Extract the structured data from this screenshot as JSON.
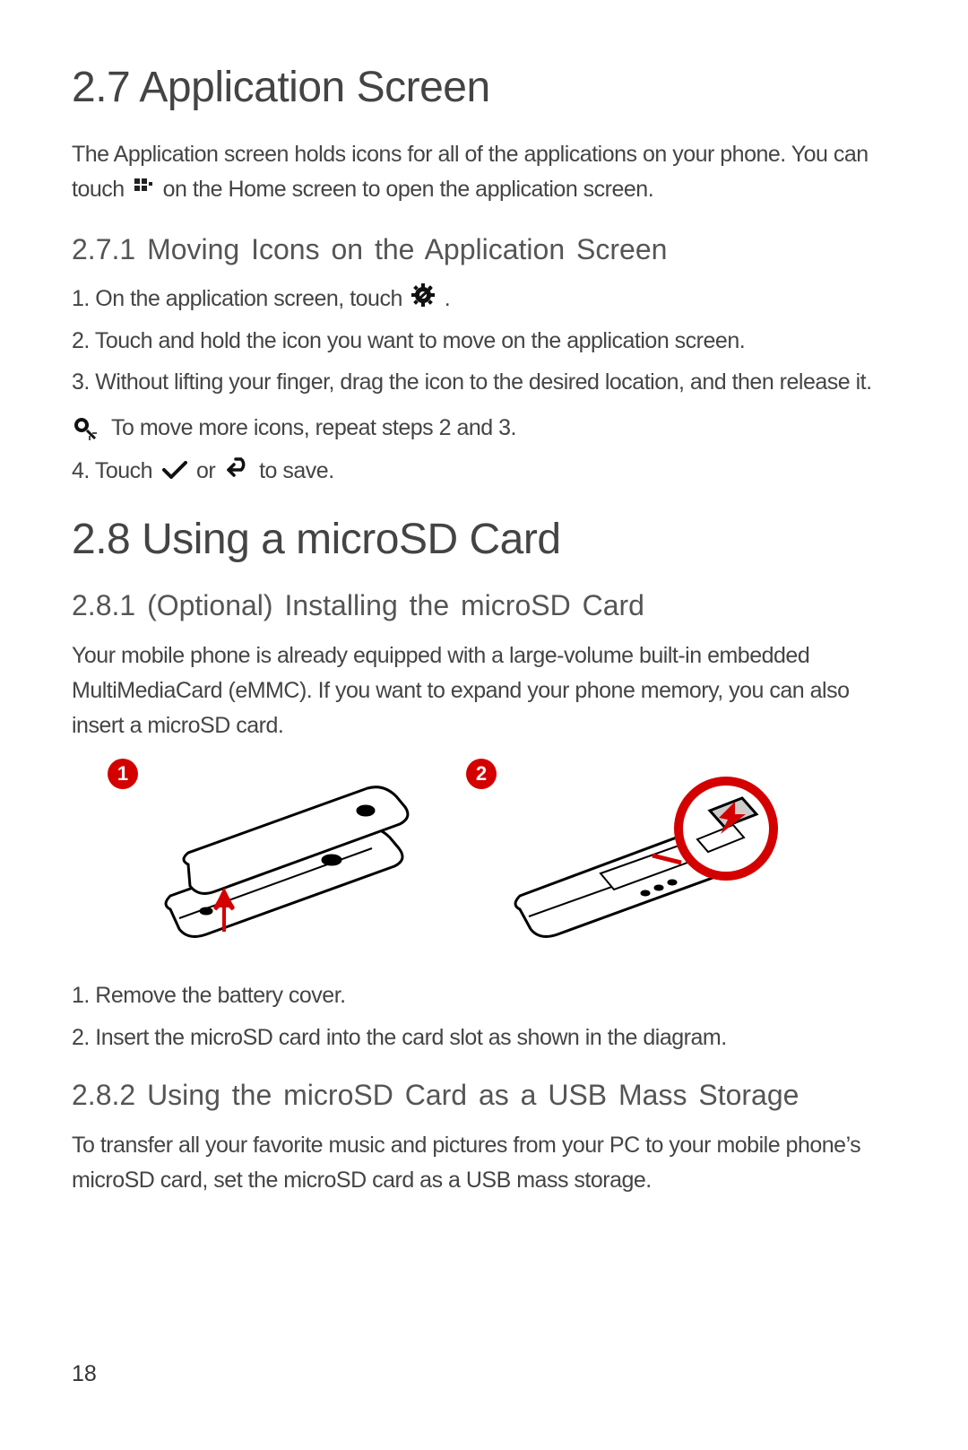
{
  "section27": {
    "heading": "2.7  Application Screen",
    "intro_part1": "The Application screen holds icons for all of the applications on your phone. You can touch ",
    "intro_part2": " on the Home screen to open the application screen.",
    "sub271": {
      "heading": "2.7.1  Moving Icons on the Application Screen",
      "step1_a": "1. On the application screen, touch ",
      "step1_b": " .",
      "step2": "2. Touch and hold the icon you want to move on the application screen.",
      "step3": "3. Without lifting your finger, drag the icon to the desired location, and then release it.",
      "note": "To move more icons, repeat steps 2 and 3.",
      "step4_a": "4. Touch ",
      "step4_b": " or ",
      "step4_c": " to save."
    }
  },
  "section28": {
    "heading": "2.8  Using a microSD Card",
    "sub281": {
      "heading": "2.8.1  (Optional) Installing the microSD Card",
      "intro": "Your mobile phone is already equipped with a large-volume built-in embedded MultiMediaCard (eMMC). If you want to expand your phone memory, you can also insert a microSD card.",
      "callout1": "1",
      "callout2": "2",
      "step1": "1. Remove the battery cover.",
      "step2": "2. Insert the microSD card into the card slot as shown in the diagram."
    },
    "sub282": {
      "heading": "2.8.2  Using the microSD Card as a USB Mass Storage",
      "intro": "To transfer all your favorite music and pictures from your PC to your mobile phone’s microSD card, set the microSD card as a USB mass storage."
    }
  },
  "page_number": "18",
  "icons": {
    "apps": "apps-grid-icon",
    "gear": "settings-gear-icon",
    "magnifier": "magnifier-note-icon",
    "check": "check-icon",
    "back": "back-arrow-icon"
  }
}
